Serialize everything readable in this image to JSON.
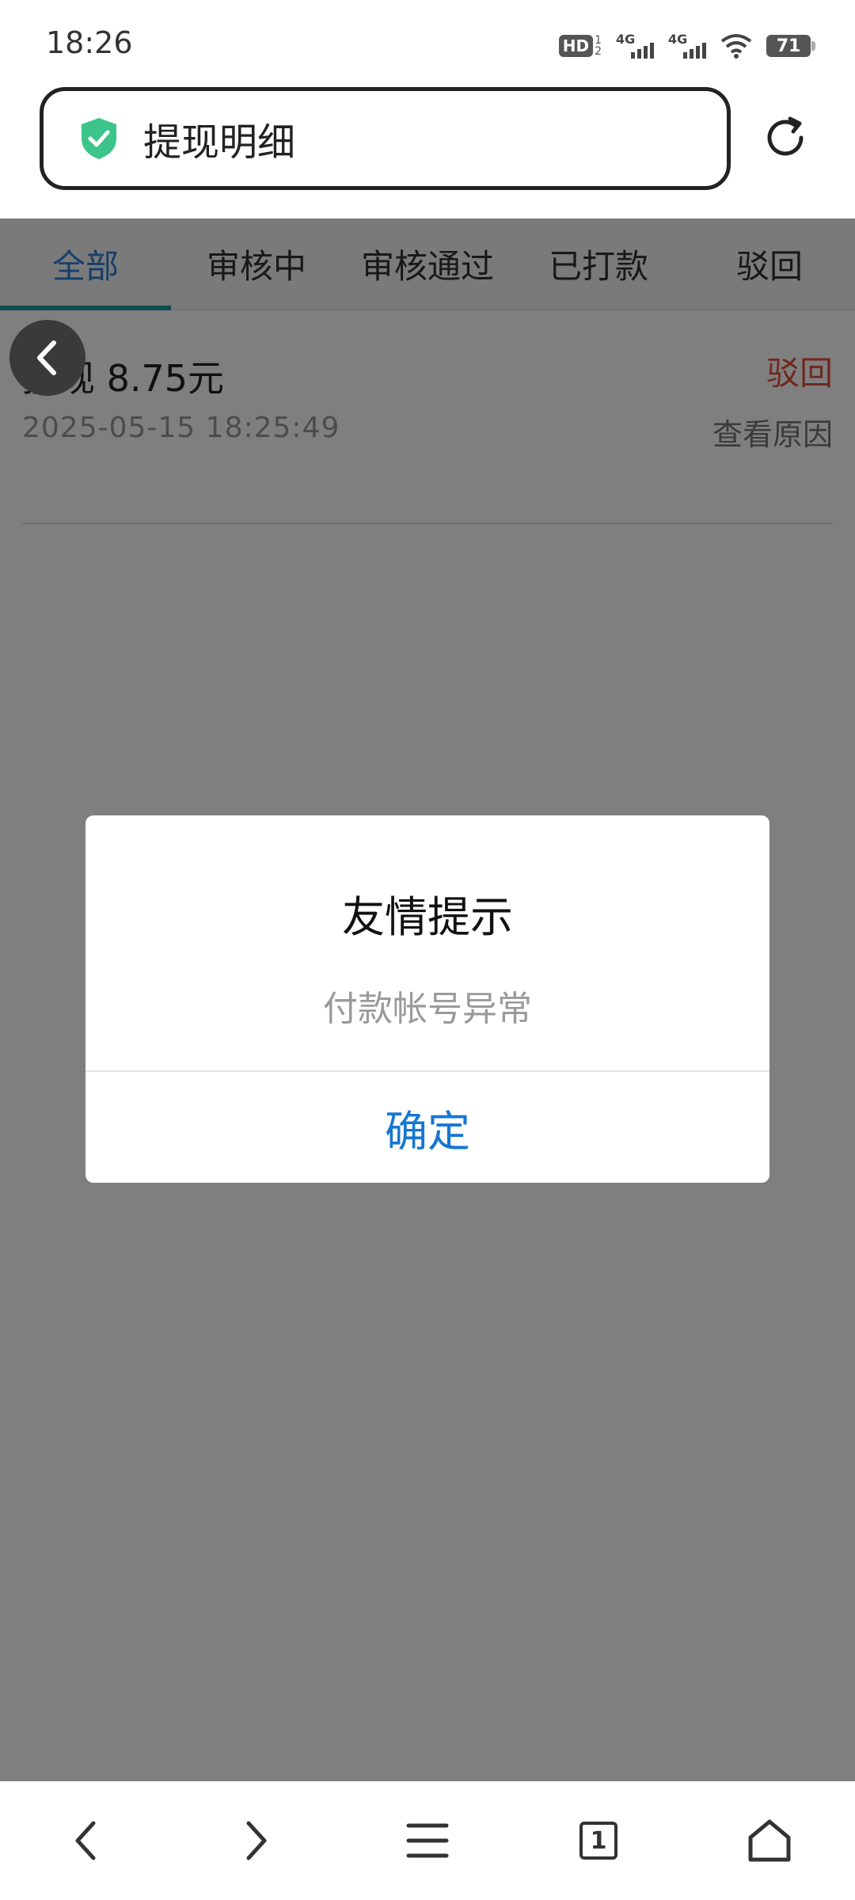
{
  "status_bar": {
    "time": "18:26",
    "hd_label": "HD",
    "hd_sub_top": "1",
    "hd_sub_bottom": "2",
    "net1_label": "4G",
    "net2_label": "4G",
    "battery": "71"
  },
  "address_bar": {
    "title": "提现明细",
    "icons": [
      "shield-check-icon",
      "reload-icon"
    ]
  },
  "tabs": [
    {
      "label": "全部",
      "active": true
    },
    {
      "label": "审核中",
      "active": false
    },
    {
      "label": "审核通过",
      "active": false
    },
    {
      "label": "已打款",
      "active": false
    },
    {
      "label": "驳回",
      "active": false
    }
  ],
  "records": [
    {
      "amount": "提现 8.75元",
      "time": "2025-05-15 18:25:49",
      "status": "驳回",
      "link": "查看原因"
    }
  ],
  "dialog": {
    "title": "友情提示",
    "message": "付款帐号异常",
    "confirm_label": "确定"
  },
  "bottom_nav": {
    "tab_count": "1",
    "icons": [
      "back-icon",
      "forward-icon",
      "menu-icon",
      "tabs-icon",
      "home-icon"
    ]
  },
  "colors": {
    "active_tab": "#2a7fd6",
    "tab_indicator": "#1a9aa0",
    "reject_status": "#e0503c",
    "confirm_button": "#1677d2",
    "shield": "#3cc48a"
  }
}
